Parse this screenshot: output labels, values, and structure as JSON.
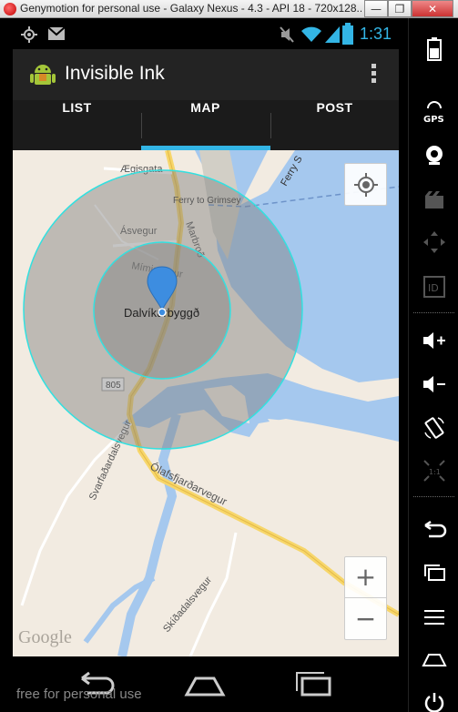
{
  "window": {
    "title": "Genymotion for personal use - Galaxy Nexus - 4.3 - API 18 - 720x128...",
    "min_label": "—",
    "max_label": "❐",
    "close_label": "✕"
  },
  "statusbar": {
    "time": "1:31"
  },
  "app": {
    "title": "Invisible Ink"
  },
  "tabs": [
    {
      "label": "LIST"
    },
    {
      "label": "MAP"
    },
    {
      "label": "POST"
    }
  ],
  "active_tab": "MAP",
  "map": {
    "labels": {
      "aegisgata": "Ægisgata",
      "ferry_to_grimsey": "Ferry to Grimsey",
      "ferry_short": "Ferry S",
      "asvegur": "Ásvegur",
      "marbrod": "Marbroð",
      "mimisvegur": "Mímisvegur",
      "dalvik": "Dalvíkurbyggð",
      "route_805": "805",
      "svarfadardalsvegur": "Svarfaðardalsvegur",
      "olafsfjardarvegur": "Ólafsfjarðarvegur",
      "skidadalsvegur": "Skíðadalsvegur"
    },
    "zoom_in": "+",
    "zoom_out": "−",
    "attribution": "Google",
    "circle_outer_color": "#7f7f7f",
    "circle_stroke_color": "#33e0e0",
    "marker_color": "#3d8de0"
  },
  "watermark": "free for personal use",
  "side_panel": [
    "battery-icon",
    "gps-icon",
    "webcam-icon",
    "video-capture-icon",
    "remote-control-icon",
    "device-id-icon",
    "volume-up-icon",
    "volume-down-icon",
    "rotate-icon",
    "pixel-perfect-icon",
    "back-icon",
    "recent-apps-icon",
    "menu-icon",
    "home-icon",
    "power-icon"
  ],
  "side_labels": {
    "gps": "GPS",
    "id": "ID",
    "one_to_one": "1:1"
  }
}
